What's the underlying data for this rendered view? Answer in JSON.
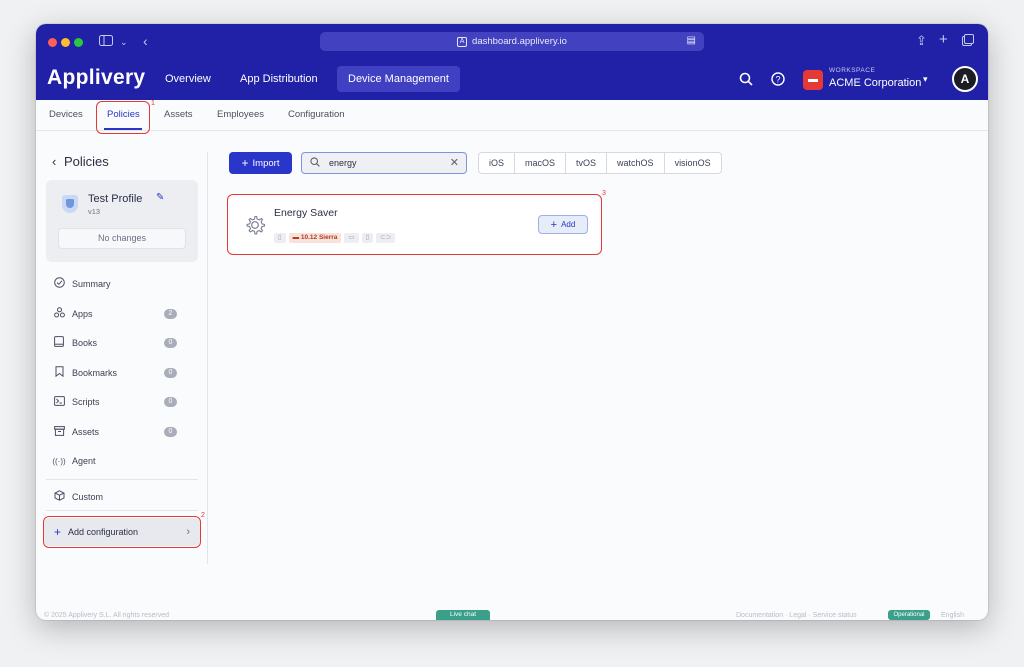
{
  "browser": {
    "url": "dashboard.applivery.io",
    "traffic_lights": [
      "#ff5f57",
      "#febc2e",
      "#28c840"
    ],
    "titlebar_color": "#2121a8"
  },
  "header": {
    "logo": "Applivery",
    "nav": [
      {
        "label": "Overview",
        "active": false
      },
      {
        "label": "App Distribution",
        "active": false
      },
      {
        "label": "Device Management",
        "active": true
      }
    ],
    "workspace_label": "WORKSPACE",
    "workspace_name": "ACME Corporation",
    "avatar_letter": "A"
  },
  "subnav": {
    "tabs": [
      {
        "label": "Devices",
        "active": false
      },
      {
        "label": "Policies",
        "active": true
      },
      {
        "label": "Assets",
        "active": false
      },
      {
        "label": "Employees",
        "active": false
      },
      {
        "label": "Configuration",
        "active": false
      }
    ]
  },
  "annotations": {
    "one": "1",
    "two": "2",
    "three": "3",
    "color": "#e53935"
  },
  "sidebar": {
    "back_label": "Policies",
    "profile": {
      "name": "Test Profile",
      "version": "v13",
      "status": "No changes"
    },
    "items": [
      {
        "label": "Summary",
        "icon": "check-circle-icon"
      },
      {
        "label": "Apps",
        "icon": "apps-icon",
        "count": "2"
      },
      {
        "label": "Books",
        "icon": "book-icon",
        "count": "0"
      },
      {
        "label": "Bookmarks",
        "icon": "bookmark-icon",
        "count": "0"
      },
      {
        "label": "Scripts",
        "icon": "terminal-icon",
        "count": "0"
      },
      {
        "label": "Assets",
        "icon": "archive-icon",
        "count": "0"
      },
      {
        "label": "Agent",
        "icon": "broadcast-icon"
      },
      {
        "label": "Custom",
        "icon": "cube-icon"
      }
    ],
    "add_configuration": "Add configuration"
  },
  "toolbar": {
    "import_label": "Import",
    "search_value": "energy",
    "platforms": [
      "iOS",
      "macOS",
      "tvOS",
      "watchOS",
      "visionOS"
    ]
  },
  "results": [
    {
      "title": "Energy Saver",
      "icon": "gear-icon",
      "platform_chips": [
        {
          "label": "",
          "icon": "phone-icon",
          "active": false
        },
        {
          "label": "10.12 Sierra",
          "icon": "laptop-icon",
          "active": true
        },
        {
          "label": "",
          "icon": "tv-icon",
          "active": false
        },
        {
          "label": "",
          "icon": "watch-icon",
          "active": false
        },
        {
          "label": "",
          "icon": "vision-icon",
          "active": false
        }
      ],
      "action": "Add"
    }
  ],
  "footer": {
    "left": "© 2025 Applivery S.L. All rights reserved",
    "center": "Live chat",
    "right": "Documentation · Legal · Service status",
    "status": "Operational",
    "lang": "English"
  },
  "colors": {
    "primary": "#2a35c9",
    "nav_bg": "#2121a8",
    "annotation": "#e53935",
    "chip_active": "#b23a1e"
  }
}
